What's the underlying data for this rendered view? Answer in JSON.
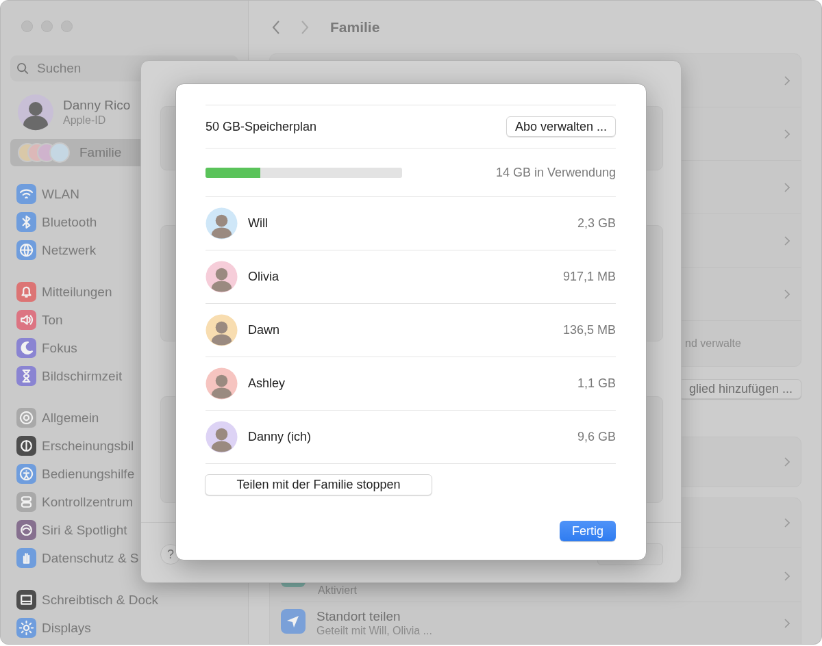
{
  "sidebar": {
    "search": {
      "placeholder": "Suchen"
    },
    "profile": {
      "name": "Danny Rico",
      "subtitle": "Apple-ID"
    },
    "family_item": {
      "label": "Familie",
      "selected": true
    },
    "groups": [
      {
        "items": [
          {
            "label": "WLAN",
            "color": "#6f9ddd"
          },
          {
            "label": "Bluetooth",
            "color": "#6f9ddd"
          },
          {
            "label": "Netzwerk",
            "color": "#6f9ddd"
          }
        ]
      },
      {
        "items": [
          {
            "label": "Mitteilungen",
            "color": "#dc7474"
          },
          {
            "label": "Ton",
            "color": "#dc7482"
          },
          {
            "label": "Fokus",
            "color": "#8a84d2"
          },
          {
            "label": "Bildschirmzeit",
            "color": "#8a84d2"
          }
        ]
      },
      {
        "items": [
          {
            "label": "Allgemein",
            "color": "#a9a9a9"
          },
          {
            "label": "Erscheinungsbil",
            "color": "#4d4d4d"
          },
          {
            "label": "Bedienungshilfe",
            "color": "#6f9ddd"
          },
          {
            "label": "Kontrollzentrum",
            "color": "#a9a9a9"
          },
          {
            "label": "Siri & Spotlight",
            "color": "#86708f"
          },
          {
            "label": "Datenschutz & S",
            "color": "#6f9ddd"
          }
        ]
      },
      {
        "items": [
          {
            "label": "Schreibtisch & Dock",
            "color": "#4d4d4d"
          },
          {
            "label": "Displays",
            "color": "#6f9ddd"
          }
        ]
      }
    ]
  },
  "content": {
    "title": "Familie",
    "note_fragment": "nd verwalte",
    "add_button": "glied hinzufügen ...",
    "service_status": "Aktiviert",
    "location": {
      "title": "Standort teilen",
      "subtitle": "Geteilt mit Will, Olivia ..."
    }
  },
  "settings_sheet": {
    "help_button": "?"
  },
  "storage_dialog": {
    "plan": "50 GB-Speicherplan",
    "manage_button": "Abo verwalten ...",
    "usage": {
      "level": 0.28,
      "label": "14 GB in Verwendung"
    },
    "members": [
      {
        "name": "Will",
        "usage": "2,3 GB",
        "color": "#cfe7f8"
      },
      {
        "name": "Olivia",
        "usage": "917,1 MB",
        "color": "#f6cdd9"
      },
      {
        "name": "Dawn",
        "usage": "136,5 MB",
        "color": "#f8ddb0"
      },
      {
        "name": "Ashley",
        "usage": "1,1 GB",
        "color": "#f6c4c0"
      },
      {
        "name": "Danny (ich)",
        "usage": "9,6 GB",
        "color": "#ddd3f5"
      }
    ],
    "stop_button": "Teilen mit der Familie stoppen",
    "done_button": "Fertig"
  }
}
